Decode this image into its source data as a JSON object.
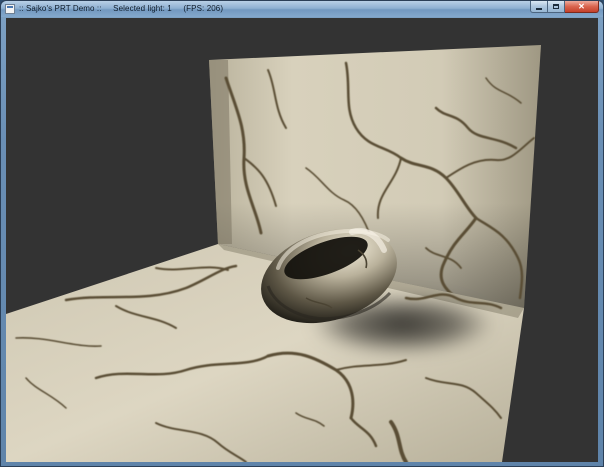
{
  "window": {
    "title": ":: Sajko's PRT Demo ::     Selected light: 1     (FPS: 206)",
    "buttons": {
      "minimize_icon": "minimize-icon",
      "maximize_icon": "maximize-icon",
      "close_icon": "close-icon",
      "close_glyph": "✕"
    }
  },
  "scene": {
    "background_color": "#333333",
    "marble_base_color": "#e4dcc8",
    "vein_color": "#5a4e34",
    "torus_color": "#d9d2bd"
  }
}
